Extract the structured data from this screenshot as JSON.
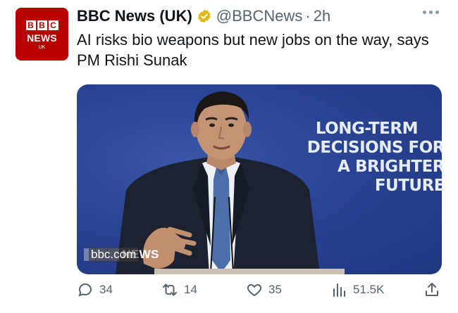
{
  "account": {
    "name": "BBC News (UK)",
    "handle": "@BBCNews",
    "separator": "·",
    "time": "2h",
    "avatar": {
      "letters": [
        "B",
        "B",
        "C"
      ],
      "line2": "NEWS",
      "line3": "UK"
    }
  },
  "tweet": {
    "text": "AI risks bio weapons but new jobs on the way, says PM Rishi Sunak"
  },
  "media": {
    "slogan_lines": [
      "LONG-TERM",
      "DECISIONS FOR",
      "A BRIGHTER",
      "FUTURE"
    ],
    "watermark": "bbc.com",
    "watermark_news": "NEWS"
  },
  "actions": {
    "replies": "34",
    "retweets": "14",
    "likes": "35",
    "views": "51.5K"
  },
  "colors": {
    "brand_red": "#b80000",
    "verified_gold": "#e2b719",
    "muted": "#536471",
    "backdrop_blue": "#2a4494"
  },
  "icons": {
    "more": "more-icon",
    "reply": "reply-icon",
    "retweet": "retweet-icon",
    "like": "heart-icon",
    "views": "views-icon",
    "share": "share-icon",
    "verified": "verified-badge-icon"
  }
}
